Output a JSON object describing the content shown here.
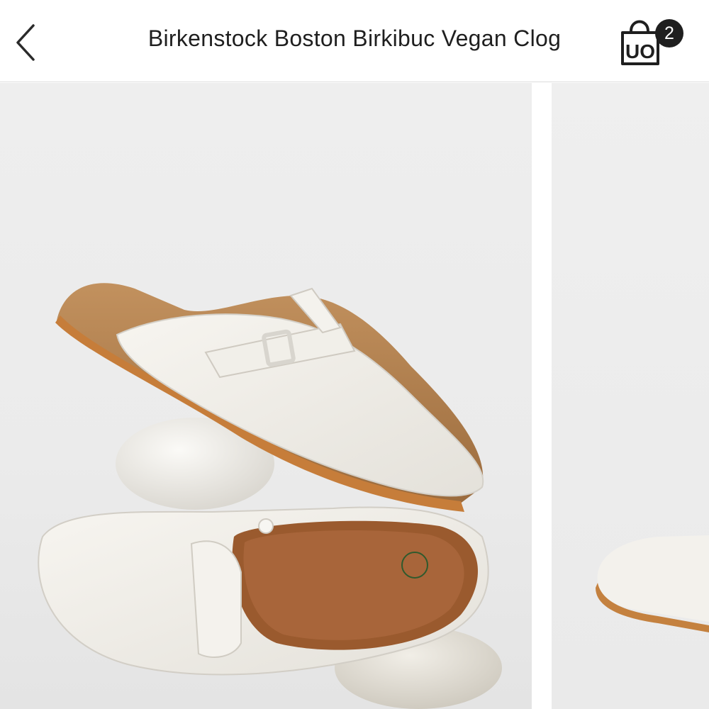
{
  "header": {
    "title": "Birkenstock Boston Birkibuc Vegan Clog",
    "back_icon": "chevron-left-icon",
    "bag_icon": "uo-shopping-bag-icon",
    "bag_logo_text": "UO",
    "bag_count": "2"
  },
  "gallery": {
    "images": [
      {
        "subject": "white Birkenstock Boston clogs stacked on stones"
      },
      {
        "subject": "white clog toe, partially visible"
      }
    ]
  },
  "colors": {
    "background": "#ffffff",
    "text": "#1f1f1f",
    "photo_bg": "#ececec",
    "clog_white": "#f3f1ec",
    "cork": "#b98654",
    "sole": "#c4813f"
  }
}
